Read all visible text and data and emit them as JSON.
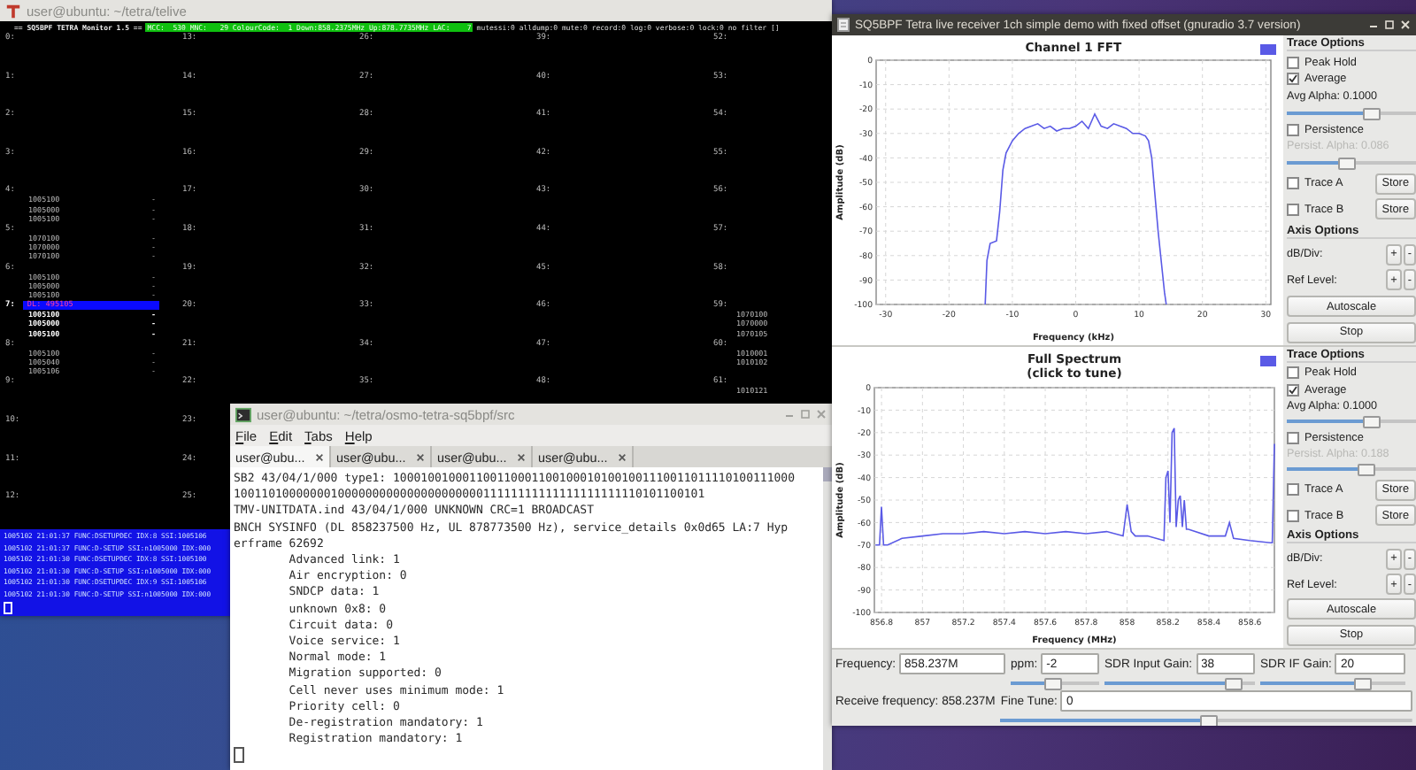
{
  "telive": {
    "title": "user@ubuntu: ~/tetra/telive",
    "header": {
      "name": "== SQ5BPF TETRA Monitor 1.5 ==",
      "network": "MCC:  530 MNC:   29 ColourCode:  1 Down:858.2375MHz Up:878.7735MHz LAC:    7",
      "flags": "mutessi:0 alldump:0 mute:0 record:0 log:0 verbose:0 lock:0 no filter []"
    },
    "slot_columns": [
      [
        {
          "label": "0:",
          "active": false
        },
        {
          "label": "1:",
          "active": false
        },
        {
          "label": "2:",
          "active": false
        },
        {
          "label": "3:",
          "active": false
        },
        {
          "label": "4:",
          "active": false,
          "entries": [
            {
              "id": "1005100",
              "mark": "-"
            },
            {
              "id": "1005000",
              "mark": "-"
            },
            {
              "id": "1005100",
              "mark": "-"
            }
          ]
        },
        {
          "label": "5:",
          "active": false,
          "entries": [
            {
              "id": "1070100",
              "mark": "-"
            },
            {
              "id": "1070000",
              "mark": "-"
            },
            {
              "id": "1070100",
              "mark": "-"
            }
          ]
        },
        {
          "label": "6:",
          "active": false,
          "entries": [
            {
              "id": "1005100",
              "mark": "-"
            },
            {
              "id": "1005000",
              "mark": "-"
            },
            {
              "id": "1005100",
              "mark": "-"
            }
          ]
        },
        {
          "label": "7:",
          "active": true,
          "call": "DL: 495105",
          "entries": [
            {
              "id": "1005100",
              "mark": "-"
            },
            {
              "id": "1005000",
              "mark": "-"
            },
            {
              "id": "1005100",
              "mark": "-"
            }
          ]
        },
        {
          "label": "8:",
          "active": false,
          "entries": [
            {
              "id": "1005100",
              "mark": "-"
            },
            {
              "id": "1005040",
              "mark": "-"
            },
            {
              "id": "1005106",
              "mark": "-"
            }
          ]
        },
        {
          "label": "9:",
          "active": false
        },
        {
          "label": "10:",
          "active": false
        },
        {
          "label": "11:",
          "active": false
        },
        {
          "label": "12:",
          "active": false
        }
      ],
      [
        {
          "label": "13:",
          "active": false
        },
        {
          "label": "14:",
          "active": false
        },
        {
          "label": "15:",
          "active": false
        },
        {
          "label": "16:",
          "active": false
        },
        {
          "label": "17:",
          "active": false
        },
        {
          "label": "18:",
          "active": false
        },
        {
          "label": "19:",
          "active": false
        },
        {
          "label": "20:",
          "active": false
        },
        {
          "label": "21:",
          "active": false
        },
        {
          "label": "22:",
          "active": false
        },
        {
          "label": "23:",
          "active": false
        },
        {
          "label": "24:",
          "active": false
        },
        {
          "label": "25:",
          "active": false
        }
      ],
      [
        {
          "label": "26:",
          "active": false
        },
        {
          "label": "27:",
          "active": false
        },
        {
          "label": "28:",
          "active": false
        },
        {
          "label": "29:",
          "active": false
        },
        {
          "label": "30:",
          "active": false
        },
        {
          "label": "31:",
          "active": false
        },
        {
          "label": "32:",
          "active": false
        },
        {
          "label": "33:",
          "active": false
        },
        {
          "label": "34:",
          "active": false
        },
        {
          "label": "35:",
          "active": false
        }
      ],
      [
        {
          "label": "39:",
          "active": false
        },
        {
          "label": "40:",
          "active": false
        },
        {
          "label": "41:",
          "active": false
        },
        {
          "label": "42:",
          "active": false
        },
        {
          "label": "43:",
          "active": false
        },
        {
          "label": "44:",
          "active": false
        },
        {
          "label": "45:",
          "active": false
        },
        {
          "label": "46:",
          "active": false
        },
        {
          "label": "47:",
          "active": false
        },
        {
          "label": "48:",
          "active": false
        }
      ],
      [
        {
          "label": "52:",
          "active": false
        },
        {
          "label": "53:",
          "active": false
        },
        {
          "label": "54:",
          "active": false
        },
        {
          "label": "55:",
          "active": false
        },
        {
          "label": "56:",
          "active": false
        },
        {
          "label": "57:",
          "active": false
        },
        {
          "label": "58:",
          "active": false
        },
        {
          "label": "59:",
          "active": false,
          "entries": [
            {
              "id": "1070100"
            },
            {
              "id": "1070000"
            },
            {
              "id": "1070105"
            }
          ]
        },
        {
          "label": "60:",
          "active": false,
          "entries": [
            {
              "id": "1010001"
            },
            {
              "id": "1010102"
            }
          ]
        },
        {
          "label": "61:",
          "active": false,
          "entries": [
            {
              "id": "1010121"
            }
          ]
        }
      ]
    ],
    "log": [
      "1005102 21:01:37 FUNC:DSETUPDEC IDX:8 SSI:1005106",
      "1005102 21:01:37 FUNC:D-SETUP SSI:n1005000 IDX:000",
      "1005102 21:01:30 FUNC:DSETUPDEC IDX:8 SSI:1005100",
      "1005102 21:01:30 FUNC:D-SETUP SSI:n1005000 IDX:000",
      "1005102 21:01:30 FUNC:DSETUPDEC IDX:9 SSI:1005106",
      "1005102 21:01:30 FUNC:D-SETUP SSI:n1005000 IDX:000"
    ]
  },
  "terminal": {
    "title": "user@ubuntu: ~/tetra/osmo-tetra-sq5bpf/src",
    "menu": [
      "File",
      "Edit",
      "Tabs",
      "Help"
    ],
    "tabs": [
      {
        "label": "user@ubu...",
        "selected": true
      },
      {
        "label": "user@ubu...",
        "selected": false
      },
      {
        "label": "user@ubu...",
        "selected": false
      },
      {
        "label": "user@ubu...",
        "selected": false
      }
    ],
    "lines": [
      "SB2 43/04/1/000 type1: 1000100100011001100011001000101001001110011011110100111000",
      "10011010000000100000000000000000000011111111111111111111110101100101",
      "TMV-UNITDATA.ind 43/04/1/000 UNKNOWN CRC=1 BROADCAST",
      "BNCH SYSINFO (DL 858237500 Hz, UL 878773500 Hz), service_details 0x0d65 LA:7 Hyp",
      "erframe 62692",
      "        Advanced link: 1",
      "        Air encryption: 0",
      "        SNDCP data: 1",
      "        unknown 0x8: 0",
      "        Circuit data: 0",
      "        Voice service: 1",
      "        Normal mode: 1",
      "        Migration supported: 0",
      "        Cell never uses minimum mode: 1",
      "        Priority cell: 0",
      "        De-registration mandatory: 1",
      "        Registration mandatory: 1"
    ]
  },
  "receiver": {
    "title": "SQ5BPF Tetra live receiver 1ch simple demo with fixed offset (gnuradio 3.7 version)",
    "plots": [
      {
        "chart_data": {
          "type": "line",
          "title": "Channel 1 FFT",
          "xlabel": "Frequency (kHz)",
          "ylabel": "Amplitude (dB)",
          "x": [
            -14.3,
            -14,
            -13.5,
            -12.5,
            -12,
            -11.5,
            -11,
            -10,
            -9,
            -8,
            -7,
            -6,
            -5,
            -4,
            -3,
            -2,
            -1,
            0,
            1,
            2,
            3,
            4,
            5,
            6,
            7,
            8,
            9,
            10,
            11,
            11.5,
            12,
            13,
            14,
            14.3
          ],
          "series": [
            {
              "color": "#5a5ae6",
              "values": [
                -100,
                -82,
                -75,
                -74,
                -62,
                -45,
                -38,
                -33,
                -30,
                -28,
                -27,
                -26,
                -28,
                -27,
                -29,
                -28,
                -28,
                -27,
                -25,
                -28,
                -22,
                -27,
                -28,
                -26,
                -27,
                -28,
                -30,
                -30,
                -31,
                -33,
                -40,
                -70,
                -95,
                -100
              ]
            }
          ],
          "grid": true,
          "xlim": [
            -31.5,
            30.8
          ],
          "ylim": [
            -100,
            0
          ],
          "xticks": [
            -30,
            -20,
            -10,
            0,
            10,
            20,
            30
          ],
          "yticks": [
            0,
            -10,
            -20,
            -30,
            -40,
            -50,
            -60,
            -70,
            -80,
            -90,
            -100
          ]
        },
        "options": [
          {
            "kind": "heading",
            "label": "Trace Options"
          },
          {
            "kind": "checkbox",
            "label": "Peak Hold",
            "checked": false
          },
          {
            "kind": "checkbox",
            "label": "Average",
            "checked": true
          },
          {
            "kind": "reading",
            "label": "Avg Alpha: 0.1000",
            "disabled": false
          },
          {
            "kind": "slider",
            "level": 0.65
          },
          {
            "kind": "checkbox",
            "label": "Persistence",
            "checked": false
          },
          {
            "kind": "reading",
            "label": "Persist. Alpha: 0.086",
            "disabled": true
          },
          {
            "kind": "slider",
            "level": 0.45
          },
          {
            "kind": "store",
            "label": "Trace A",
            "checked": false,
            "button": "Store"
          },
          {
            "kind": "store",
            "label": "Trace B",
            "checked": false,
            "button": "Store"
          },
          {
            "kind": "heading",
            "label": "Axis Options"
          },
          {
            "kind": "stepper",
            "label": "dB/Div:",
            "buttons": [
              "+",
              "-"
            ]
          },
          {
            "kind": "stepper",
            "label": "Ref Level:",
            "buttons": [
              "+",
              "-"
            ]
          },
          {
            "kind": "button",
            "label": "Autoscale"
          },
          {
            "kind": "button",
            "label": "Stop"
          }
        ]
      },
      {
        "chart_data": {
          "type": "line",
          "title": "Full Spectrum\n(click to tune)",
          "xlabel": "Frequency (MHz)",
          "ylabel": "Amplitude (dB)",
          "x": [
            856.77,
            856.79,
            856.8,
            856.81,
            856.83,
            856.9,
            857,
            857.1,
            857.2,
            857.3,
            857.4,
            857.5,
            857.6,
            857.7,
            857.8,
            857.9,
            857.98,
            858.0,
            858.02,
            858.04,
            858.1,
            858.18,
            858.19,
            858.2,
            858.21,
            858.22,
            858.23,
            858.24,
            858.25,
            858.26,
            858.27,
            858.28,
            858.29,
            858.3,
            858.4,
            858.48,
            858.5,
            858.52,
            858.6,
            858.7,
            858.71,
            858.72
          ],
          "series": [
            {
              "color": "#5a5ae6",
              "values": [
                -70,
                -70,
                -53,
                -70,
                -70,
                -67,
                -66,
                -65,
                -65,
                -64,
                -65,
                -64,
                -65,
                -64,
                -65,
                -64,
                -66,
                -52,
                -64,
                -66,
                -66,
                -68,
                -40,
                -37,
                -60,
                -20,
                -18,
                -62,
                -50,
                -48,
                -62,
                -50,
                -63,
                -63,
                -66,
                -66,
                -60,
                -67,
                -68,
                -69,
                -69,
                -25
              ]
            }
          ],
          "grid": true,
          "xlim": [
            856.765,
            858.72
          ],
          "ylim": [
            -100,
            0
          ],
          "xticks": [
            856.8,
            857,
            857.2,
            857.4,
            857.6,
            857.8,
            858,
            858.2,
            858.4,
            858.6
          ],
          "yticks": [
            0,
            -10,
            -20,
            -30,
            -40,
            -50,
            -60,
            -70,
            -80,
            -90,
            -100
          ]
        },
        "options": [
          {
            "kind": "heading",
            "label": "Trace Options"
          },
          {
            "kind": "checkbox",
            "label": "Peak Hold",
            "checked": false
          },
          {
            "kind": "checkbox",
            "label": "Average",
            "checked": true
          },
          {
            "kind": "reading",
            "label": "Avg Alpha: 0.1000",
            "disabled": false
          },
          {
            "kind": "slider",
            "level": 0.65
          },
          {
            "kind": "checkbox",
            "label": "Persistence",
            "checked": false
          },
          {
            "kind": "reading",
            "label": "Persist. Alpha: 0.188",
            "disabled": true
          },
          {
            "kind": "slider",
            "level": 0.6
          },
          {
            "kind": "store",
            "label": "Trace A",
            "checked": false,
            "button": "Store"
          },
          {
            "kind": "store",
            "label": "Trace B",
            "checked": false,
            "button": "Store"
          },
          {
            "kind": "heading",
            "label": "Axis Options"
          },
          {
            "kind": "stepper",
            "label": "dB/Div:",
            "buttons": [
              "+",
              "-"
            ]
          },
          {
            "kind": "stepper",
            "label": "Ref Level:",
            "buttons": [
              "+",
              "-"
            ]
          },
          {
            "kind": "button",
            "label": "Autoscale"
          },
          {
            "kind": "button",
            "label": "Stop"
          }
        ]
      }
    ],
    "controls": {
      "frequency": {
        "label": "Frequency:",
        "value": "858.237M"
      },
      "adjusters": [
        {
          "label": "ppm:",
          "value": "-2",
          "level": 0.45
        },
        {
          "label": "SDR Input Gain:",
          "value": "38",
          "level": 0.85
        },
        {
          "label": "SDR IF Gain:",
          "value": "20",
          "level": 0.7
        }
      ],
      "receive": "Receive frequency: 858.237M",
      "fine_tune": {
        "label": "Fine Tune:",
        "value": "0",
        "level": 0.5
      }
    }
  }
}
